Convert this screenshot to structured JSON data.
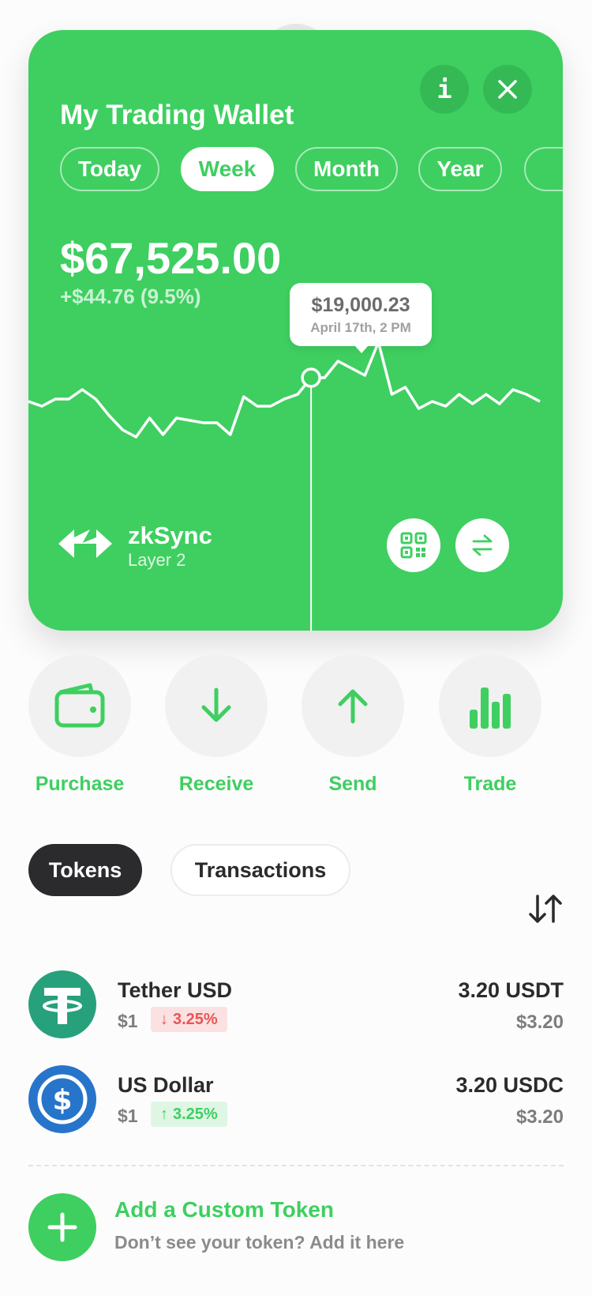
{
  "wallet": {
    "title": "My Trading Wallet",
    "info_icon": "info-icon",
    "close_icon": "close-icon",
    "periods": [
      "Today",
      "Week",
      "Month",
      "Year",
      ""
    ],
    "active_period": "Week",
    "balance": "$67,525.00",
    "change": "+$44.76 (9.5%)",
    "tooltip": {
      "value": "$19,000.23",
      "date": "April 17th, 2 PM"
    },
    "network": {
      "name": "zkSync",
      "subtitle": "Layer 2"
    },
    "accent": "#3ecf60"
  },
  "chart_data": {
    "type": "line",
    "values": [
      50,
      48,
      51,
      51,
      55,
      51,
      44,
      38,
      35,
      43,
      36,
      43,
      42,
      41,
      41,
      36,
      52,
      48,
      48,
      51,
      53,
      60,
      60,
      67,
      64,
      61,
      75,
      53,
      56,
      47,
      50,
      48,
      53,
      49,
      53,
      49,
      55,
      53,
      50
    ],
    "highlight_index": 21,
    "ylim": [
      0,
      100
    ]
  },
  "actions": [
    {
      "label": "Purchase",
      "icon": "wallet-icon"
    },
    {
      "label": "Receive",
      "icon": "arrow-down-icon"
    },
    {
      "label": "Send",
      "icon": "arrow-up-icon"
    },
    {
      "label": "Trade",
      "icon": "bar-chart-icon"
    }
  ],
  "tabs": {
    "tokens": "Tokens",
    "transactions": "Transactions"
  },
  "tokens": [
    {
      "name": "Tether USD",
      "price": "$1",
      "change": "3.25%",
      "direction": "down",
      "amount": "3.20 USDT",
      "usd": "$3.20",
      "logo_color": "#26a17b"
    },
    {
      "name": "US Dollar",
      "price": "$1",
      "change": "3.25%",
      "direction": "up",
      "amount": "3.20 USDC",
      "usd": "$3.20",
      "logo_color": "#2775ca"
    }
  ],
  "add_token": {
    "title": "Add a Custom Token",
    "subtitle": "Don’t see your token? Add it here"
  }
}
